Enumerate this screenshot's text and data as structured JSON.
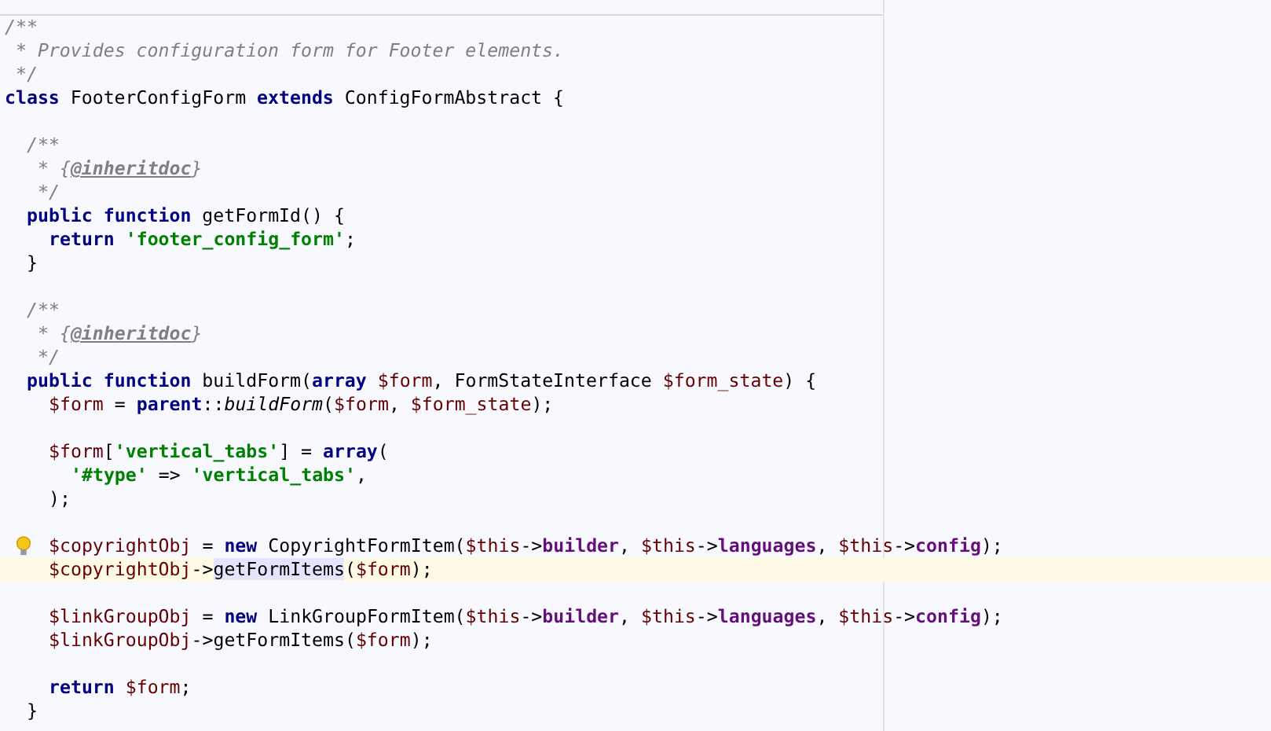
{
  "editor": {
    "lines": [
      {
        "kind": "code",
        "current": false,
        "bulb": false,
        "tokens": [
          {
            "text": "/**",
            "kind": "comment"
          }
        ]
      },
      {
        "kind": "code",
        "current": false,
        "bulb": false,
        "tokens": [
          {
            "text": " * Provides configuration form for Footer elements.",
            "kind": "comment"
          }
        ]
      },
      {
        "kind": "code",
        "current": false,
        "bulb": false,
        "tokens": [
          {
            "text": " */",
            "kind": "comment"
          }
        ]
      },
      {
        "kind": "code",
        "current": false,
        "bulb": false,
        "tokens": [
          {
            "text": "class",
            "kind": "keyword"
          },
          {
            "text": " FooterConfigForm ",
            "kind": "plain"
          },
          {
            "text": "extends",
            "kind": "keyword"
          },
          {
            "text": " ConfigFormAbstract {",
            "kind": "plain"
          }
        ]
      },
      {
        "kind": "blank"
      },
      {
        "kind": "code",
        "current": false,
        "bulb": false,
        "tokens": [
          {
            "text": "  /**",
            "kind": "comment"
          }
        ]
      },
      {
        "kind": "code",
        "current": false,
        "bulb": false,
        "tokens": [
          {
            "text": "   * {",
            "kind": "comment"
          },
          {
            "text": "@inheritdoc",
            "kind": "doctag"
          },
          {
            "text": "}",
            "kind": "comment"
          }
        ]
      },
      {
        "kind": "code",
        "current": false,
        "bulb": false,
        "tokens": [
          {
            "text": "   */",
            "kind": "comment"
          }
        ]
      },
      {
        "kind": "code",
        "current": false,
        "bulb": false,
        "tokens": [
          {
            "text": "  public function",
            "kind": "keyword"
          },
          {
            "text": " getFormId() {",
            "kind": "plain"
          }
        ]
      },
      {
        "kind": "code",
        "current": false,
        "bulb": false,
        "tokens": [
          {
            "text": "    return",
            "kind": "keyword"
          },
          {
            "text": " 'footer_config_form'",
            "kind": "string"
          },
          {
            "text": ";",
            "kind": "plain"
          }
        ]
      },
      {
        "kind": "code",
        "current": false,
        "bulb": false,
        "tokens": [
          {
            "text": "  }",
            "kind": "plain"
          }
        ]
      },
      {
        "kind": "blank"
      },
      {
        "kind": "code",
        "current": false,
        "bulb": false,
        "tokens": [
          {
            "text": "  /**",
            "kind": "comment"
          }
        ]
      },
      {
        "kind": "code",
        "current": false,
        "bulb": false,
        "tokens": [
          {
            "text": "   * {",
            "kind": "comment"
          },
          {
            "text": "@inheritdoc",
            "kind": "doctag"
          },
          {
            "text": "}",
            "kind": "comment"
          }
        ]
      },
      {
        "kind": "code",
        "current": false,
        "bulb": false,
        "tokens": [
          {
            "text": "   */",
            "kind": "comment"
          }
        ]
      },
      {
        "kind": "code",
        "current": false,
        "bulb": false,
        "tokens": [
          {
            "text": "  public function",
            "kind": "keyword"
          },
          {
            "text": " buildForm(",
            "kind": "plain"
          },
          {
            "text": "array",
            "kind": "keyword"
          },
          {
            "text": " $form",
            "kind": "variable"
          },
          {
            "text": ", FormStateInterface",
            "kind": "plain"
          },
          {
            "text": " $form_state",
            "kind": "variable"
          },
          {
            "text": ") {",
            "kind": "plain"
          }
        ]
      },
      {
        "kind": "code",
        "current": false,
        "bulb": false,
        "tokens": [
          {
            "text": "    $form",
            "kind": "variable"
          },
          {
            "text": " = ",
            "kind": "plain"
          },
          {
            "text": "parent",
            "kind": "keyword"
          },
          {
            "text": "::",
            "kind": "plain"
          },
          {
            "text": "buildForm",
            "kind": "static-call"
          },
          {
            "text": "(",
            "kind": "plain"
          },
          {
            "text": "$form",
            "kind": "variable"
          },
          {
            "text": ", ",
            "kind": "plain"
          },
          {
            "text": "$form_state",
            "kind": "variable"
          },
          {
            "text": ");",
            "kind": "plain"
          }
        ]
      },
      {
        "kind": "blank"
      },
      {
        "kind": "code",
        "current": false,
        "bulb": false,
        "tokens": [
          {
            "text": "    $form",
            "kind": "variable"
          },
          {
            "text": "[",
            "kind": "plain"
          },
          {
            "text": "'vertical_tabs'",
            "kind": "string"
          },
          {
            "text": "] = ",
            "kind": "plain"
          },
          {
            "text": "array",
            "kind": "keyword"
          },
          {
            "text": "(",
            "kind": "plain"
          }
        ]
      },
      {
        "kind": "code",
        "current": false,
        "bulb": false,
        "tokens": [
          {
            "text": "      '#type'",
            "kind": "string"
          },
          {
            "text": " => ",
            "kind": "plain"
          },
          {
            "text": "'vertical_tabs'",
            "kind": "string"
          },
          {
            "text": ",",
            "kind": "plain"
          }
        ]
      },
      {
        "kind": "code",
        "current": false,
        "bulb": false,
        "tokens": [
          {
            "text": "    );",
            "kind": "plain"
          }
        ]
      },
      {
        "kind": "blank"
      },
      {
        "kind": "code",
        "current": false,
        "bulb": true,
        "tokens": [
          {
            "text": "    $copyrightObj",
            "kind": "variable"
          },
          {
            "text": " = ",
            "kind": "plain"
          },
          {
            "text": "new",
            "kind": "keyword"
          },
          {
            "text": " CopyrightFormItem(",
            "kind": "plain"
          },
          {
            "text": "$this",
            "kind": "variable"
          },
          {
            "text": "->",
            "kind": "plain"
          },
          {
            "text": "builder",
            "kind": "field"
          },
          {
            "text": ", ",
            "kind": "plain"
          },
          {
            "text": "$this",
            "kind": "variable"
          },
          {
            "text": "->",
            "kind": "plain"
          },
          {
            "text": "languages",
            "kind": "field"
          },
          {
            "text": ", ",
            "kind": "plain"
          },
          {
            "text": "$this",
            "kind": "variable"
          },
          {
            "text": "->",
            "kind": "plain"
          },
          {
            "text": "config",
            "kind": "field"
          },
          {
            "text": ");",
            "kind": "plain"
          }
        ]
      },
      {
        "kind": "code",
        "current": true,
        "bulb": false,
        "tokens": [
          {
            "text": "    $copyrightObj",
            "kind": "variable"
          },
          {
            "text": "->",
            "kind": "plain"
          },
          {
            "text": "getFormItems",
            "kind": "highlighted"
          },
          {
            "text": "(",
            "kind": "plain"
          },
          {
            "text": "$form",
            "kind": "variable"
          },
          {
            "text": ");",
            "kind": "plain"
          }
        ]
      },
      {
        "kind": "blank"
      },
      {
        "kind": "code",
        "current": false,
        "bulb": false,
        "tokens": [
          {
            "text": "    $linkGroupObj",
            "kind": "variable"
          },
          {
            "text": " = ",
            "kind": "plain"
          },
          {
            "text": "new",
            "kind": "keyword"
          },
          {
            "text": " LinkGroupFormItem(",
            "kind": "plain"
          },
          {
            "text": "$this",
            "kind": "variable"
          },
          {
            "text": "->",
            "kind": "plain"
          },
          {
            "text": "builder",
            "kind": "field"
          },
          {
            "text": ", ",
            "kind": "plain"
          },
          {
            "text": "$this",
            "kind": "variable"
          },
          {
            "text": "->",
            "kind": "plain"
          },
          {
            "text": "languages",
            "kind": "field"
          },
          {
            "text": ", ",
            "kind": "plain"
          },
          {
            "text": "$this",
            "kind": "variable"
          },
          {
            "text": "->",
            "kind": "plain"
          },
          {
            "text": "config",
            "kind": "field"
          },
          {
            "text": ");",
            "kind": "plain"
          }
        ]
      },
      {
        "kind": "code",
        "current": false,
        "bulb": false,
        "tokens": [
          {
            "text": "    $linkGroupObj",
            "kind": "variable"
          },
          {
            "text": "->getFormItems(",
            "kind": "plain"
          },
          {
            "text": "$form",
            "kind": "variable"
          },
          {
            "text": ");",
            "kind": "plain"
          }
        ]
      },
      {
        "kind": "blank"
      },
      {
        "kind": "code",
        "current": false,
        "bulb": false,
        "tokens": [
          {
            "text": "    return",
            "kind": "keyword"
          },
          {
            "text": " $form",
            "kind": "variable"
          },
          {
            "text": ";",
            "kind": "plain"
          }
        ]
      },
      {
        "kind": "code",
        "current": false,
        "bulb": false,
        "tokens": [
          {
            "text": "  }",
            "kind": "plain"
          }
        ]
      }
    ]
  }
}
